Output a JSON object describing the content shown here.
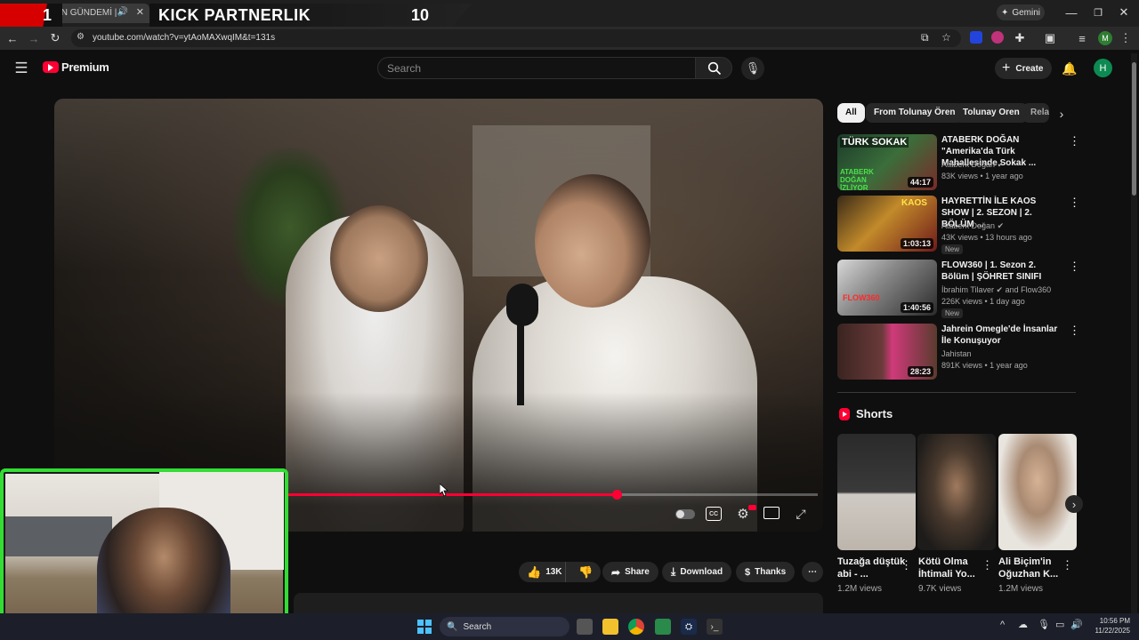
{
  "browser": {
    "tab_title": "IN GÜNDEMİ |",
    "overlay_banner_left": "1",
    "overlay_banner_main": "KICK PARTNERLIK",
    "overlay_banner_right": "10",
    "gemini_label": "Gemini",
    "url": "youtube.com/watch?v=ytAoMAXwqIM&t=131s",
    "profile_initial": "M"
  },
  "youtube": {
    "logo_text": "Premium",
    "search_placeholder": "Search",
    "create_label": "Create",
    "avatar_initial": "H"
  },
  "chips": [
    "All",
    "From Tolunay Ören",
    "Tolunay Oren",
    "Rela"
  ],
  "recommendations": [
    {
      "title": "ATABERK DOĞAN \"Amerika'da Türk Mahallesinde Sokak ...",
      "channel": "Ataberk Doğan",
      "verified": true,
      "meta": "83K views • 1 year ago",
      "duration": "44:17",
      "badge": ""
    },
    {
      "title": "HAYRETTİN İLE KAOS SHOW | 2. SEZON | 2. BÖLÜM ...",
      "channel": "Ataberk Doğan",
      "verified": true,
      "meta": "43K views • 13 hours ago",
      "duration": "1:03:13",
      "badge": "New"
    },
    {
      "title": "FLOW360 | 1. Sezon 2. Bölüm | ŞÖHRET SINIFI",
      "channel": "İbrahim Tilaver",
      "channel_extra": "and Flow360",
      "verified": true,
      "meta": "226K views • 1 day ago",
      "duration": "1:40:56",
      "badge": "New"
    },
    {
      "title": "Jahrein Omegle'de İnsanlar İle Konuşuyor",
      "channel": "Jahistan",
      "verified": false,
      "meta": "891K views • 1 year ago",
      "duration": "28:23",
      "badge": ""
    }
  ],
  "thumb_texts": {
    "t1_top": "TÜRK SOKAK",
    "t1_bottom": "ATABERK DOĞAN İZLİYOR",
    "t2_top": "KAOS",
    "t3_label": "FLOW360"
  },
  "shorts": {
    "heading": "Shorts",
    "items": [
      {
        "title": "Tuzağa düştük abi - ...",
        "views": "1.2M views"
      },
      {
        "title": "Kötü Olma İhtimali Yo...",
        "views": "9.7K views"
      },
      {
        "title": "Ali Biçim'in Oğuzhan K...",
        "views": "1.2M views"
      }
    ]
  },
  "actions": {
    "likes": "13K",
    "share": "Share",
    "download": "Download",
    "thanks": "Thanks"
  },
  "player": {
    "progress_fraction": 0.62
  },
  "taskbar": {
    "search_label": "Search",
    "time": "10:56 PM",
    "date": "11/22/2025"
  },
  "colors": {
    "accent_red": "#ff0033",
    "webcam_border": "#33dd33"
  }
}
